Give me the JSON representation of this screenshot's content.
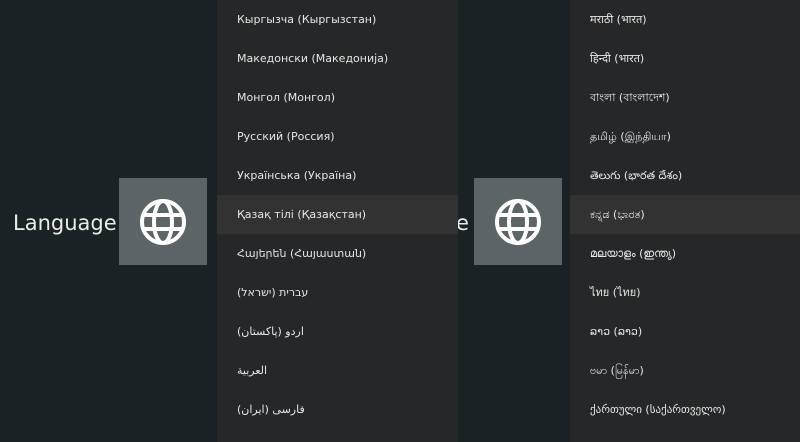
{
  "left_screen": {
    "title": "Language",
    "items": [
      {
        "label": "Кыргызча (Кыргызстан)"
      },
      {
        "label": "Македонски (Македонија)"
      },
      {
        "label": "Монгол (Монгол)"
      },
      {
        "label": "Русский (Россия)"
      },
      {
        "label": "Українська (Україна)"
      },
      {
        "label": "Қазақ тілі (Қазақстан)"
      },
      {
        "label": "Հայերեն (Հայաստան)"
      },
      {
        "label": "עברית (ישראל)"
      },
      {
        "label": "اردو (پاکستان)"
      },
      {
        "label": "العربية"
      },
      {
        "label": "فارسی (ایران)"
      }
    ],
    "selected_index": 5
  },
  "right_screen": {
    "title_fragment": "e",
    "items": [
      {
        "label": "मराठी (भारत)"
      },
      {
        "label": "हिन्दी (भारत)"
      },
      {
        "label": "বাংলা (বাংলাদেশ)"
      },
      {
        "label": "தமிழ் (இந்தியா)"
      },
      {
        "label": "తెలుగు (భారత దేశం)"
      },
      {
        "label": "ಕನ್ನಡ (ಭಾರತ)"
      },
      {
        "label": "മലയാളം (ഇന്ത്യ)"
      },
      {
        "label": "ไทย (ไทย)"
      },
      {
        "label": "ລາວ (ລາວ)"
      },
      {
        "label": "ဗမာ (မြန်မာ)"
      },
      {
        "label": "ქართული (საქართველო)"
      }
    ],
    "selected_index": 5
  },
  "icon": "globe-icon",
  "colors": {
    "background": "#1b2224",
    "panel": "#262728",
    "tile": "#5c6465",
    "selected": "#323232",
    "text": "#e7e7e7"
  }
}
